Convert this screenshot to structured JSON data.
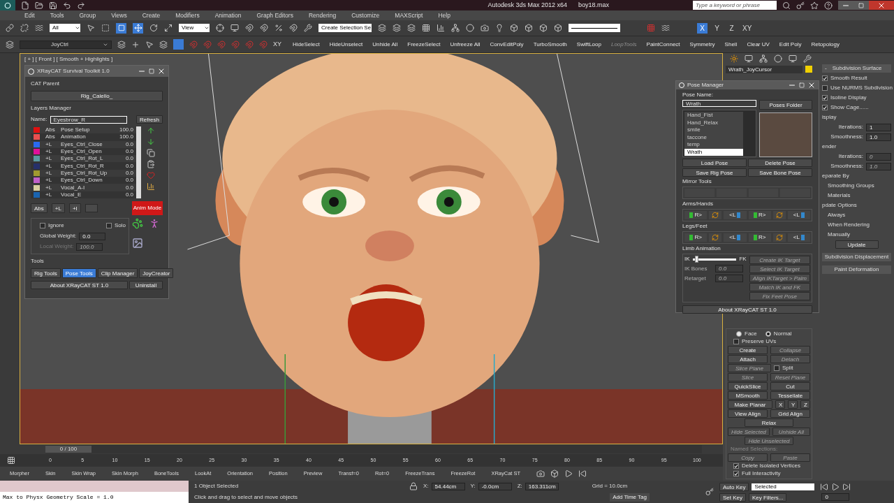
{
  "title_bar": {
    "app_title": "Autodesk 3ds Max  2012 x64",
    "file_name": "boy18.max",
    "search_placeholder": "Type a keyword or phrase"
  },
  "menu": [
    "Edit",
    "Tools",
    "Group",
    "Views",
    "Create",
    "Modifiers",
    "Animation",
    "Graph Editors",
    "Rendering",
    "Customize",
    "MAXScript",
    "Help"
  ],
  "main_toolbar": {
    "selection_filter": "All",
    "reference_coord": "View",
    "named_selection": "Create Selection Se",
    "axes": [
      {
        "label": "X",
        "selected": true
      },
      {
        "label": "Y",
        "selected": false
      },
      {
        "label": "Z",
        "selected": false
      },
      {
        "label": "XY",
        "selected": false
      }
    ]
  },
  "ribbon": {
    "layer": "JoyCtrl",
    "snap_label": "XY",
    "buttons": [
      {
        "label": "HideSelect",
        "disabled": false
      },
      {
        "label": "HideUnselect",
        "disabled": false
      },
      {
        "label": "Unhide All",
        "disabled": false
      },
      {
        "label": "FreezeSelect",
        "disabled": false
      },
      {
        "label": "Unfreeze All",
        "disabled": false
      },
      {
        "label": "ConvEditPoly",
        "disabled": false
      },
      {
        "label": "TurboSmooth",
        "disabled": false
      },
      {
        "label": "SwiftLoop",
        "disabled": false
      },
      {
        "label": "LoopTools",
        "disabled": true
      },
      {
        "label": "PaintConnect",
        "disabled": false
      },
      {
        "label": "Symmetry",
        "disabled": false
      },
      {
        "label": "Shell",
        "disabled": false
      },
      {
        "label": "Clear UV",
        "disabled": false
      },
      {
        "label": "Edit Poly",
        "disabled": false
      },
      {
        "label": "Retopology",
        "disabled": false
      }
    ]
  },
  "viewport": {
    "label": "[ + ] [ Front ] [ Smooth + Highlights ]"
  },
  "xraycat": {
    "title": "XRayCAT Survival Toolkit 1.0",
    "cat_parent_label": "CAT Parent",
    "cat_parent": "Rig_Calello_",
    "layers_label": "Layers Manager",
    "name_label": "Name:",
    "name_value": "Eyesbrow_R",
    "refresh": "Refresh",
    "layers": [
      {
        "color": "#e01010",
        "type": "Abs",
        "name": "Pose Setup",
        "weight": "100.0"
      },
      {
        "color": "#e85050",
        "type": "Abs",
        "name": "Animation",
        "weight": "100.0"
      },
      {
        "color": "#2a6af0",
        "type": "+L",
        "name": "Eyes_Ctrl_Close",
        "weight": "0.0"
      },
      {
        "color": "#e0109a",
        "type": "+L",
        "name": "Eyes_Ctrl_Open",
        "weight": "0.0"
      },
      {
        "color": "#5a9aa0",
        "type": "+L",
        "name": "Eyes_Ctrl_Rot_L",
        "weight": "0.0"
      },
      {
        "color": "#26306a",
        "type": "+L",
        "name": "Eyes_Ctrl_Rot_R",
        "weight": "0.0"
      },
      {
        "color": "#a09a30",
        "type": "+L",
        "name": "Eyes_Ctrl_Rot_Up",
        "weight": "0.0"
      },
      {
        "color": "#c060c8",
        "type": "+L",
        "name": "Eyes_Ctrl_Down",
        "weight": "0.0"
      },
      {
        "color": "#d8d0a0",
        "type": "+L",
        "name": "Vocal_A-I",
        "weight": "0.0"
      },
      {
        "color": "#1a64b0",
        "type": "+L",
        "name": "Vocal_E",
        "weight": "0.0"
      }
    ],
    "add_buttons": [
      "Abs",
      "+L",
      "+I"
    ],
    "anim_mode": "Anim Mode",
    "ignore": {
      "label": "Ignore",
      "checked": false
    },
    "solo": {
      "label": "Solo",
      "checked": false
    },
    "global_weight": {
      "label": "Global Weight:",
      "value": "0.0",
      "disabled": false
    },
    "local_weight": {
      "label": "Local Weight:",
      "value": "100.0",
      "disabled": true
    },
    "tools_label": "Tools",
    "tools": [
      {
        "label": "Rig Tools",
        "selected": false
      },
      {
        "label": "Pose Tools",
        "selected": true
      },
      {
        "label": "Clip Manager",
        "selected": false
      },
      {
        "label": "JoyCreator",
        "selected": false
      }
    ],
    "about": "About XRayCAT ST 1.0",
    "uninstall": "Uninstall"
  },
  "pose_manager": {
    "title": "Pose Manager",
    "pose_name_label": "Pose Name:",
    "pose_name": "Wrath",
    "poses_folder": "Poses Folder",
    "poses": [
      {
        "label": "Hand_Fist",
        "selected": false
      },
      {
        "label": "Hand_Relax",
        "selected": false
      },
      {
        "label": "smile",
        "selected": false
      },
      {
        "label": "taccone",
        "selected": false
      },
      {
        "label": "temp",
        "selected": false
      },
      {
        "label": "Wrath",
        "selected": true
      }
    ],
    "actions": [
      "Load Pose",
      "Delete Pose",
      "Save Rig Pose",
      "Save Bone Pose"
    ],
    "mirror_label": "Mirror Tools",
    "arms_label": "Arms/Hands",
    "legs_label": "Legs/Feet",
    "arms_buttons": [
      {
        "kind": "right",
        "label": "R>"
      },
      {
        "kind": "swap"
      },
      {
        "kind": "left",
        "label": "<L"
      },
      {
        "kind": "right",
        "label": "R>"
      },
      {
        "kind": "swap"
      },
      {
        "kind": "left",
        "label": "<L"
      }
    ],
    "legs_buttons": [
      {
        "kind": "right",
        "label": "R>"
      },
      {
        "kind": "swap"
      },
      {
        "kind": "left",
        "label": "<L"
      },
      {
        "kind": "right",
        "label": "R>"
      },
      {
        "kind": "swap"
      },
      {
        "kind": "left",
        "label": "<L"
      }
    ],
    "limb_label": "Limb Animation",
    "ik": "IK",
    "fk": "FK",
    "blend": {
      "level": 0.05
    },
    "ik_bones": {
      "label": "IK Bones",
      "value": "0.0"
    },
    "retarget": {
      "label": "Retarget",
      "value": "0.0"
    },
    "ik_actions": [
      "Create IK Target",
      "Select IK Target",
      "Align IKTarget > Palm",
      "Match IK and FK",
      "Fix Feet Pose"
    ],
    "about": "About XRayCAT ST 1.0"
  },
  "command_panel": {
    "object_name": "Wrath_JoyCursor",
    "edit_poly": [
      {
        "kind": "radios",
        "items": [
          {
            "label": "Face",
            "selected": false
          },
          {
            "label": "Normal",
            "selected": true
          }
        ]
      },
      {
        "kind": "check",
        "label": "Preserve UVs",
        "checked": false
      },
      {
        "kind": "pair",
        "items": [
          {
            "label": "Create",
            "disabled": false
          },
          {
            "label": "Collapse",
            "disabled": true
          }
        ]
      },
      {
        "kind": "pair",
        "items": [
          {
            "label": "Attach",
            "disabled": false
          },
          {
            "label": "Detach",
            "disabled": true
          }
        ]
      },
      {
        "kind": "split",
        "button": {
          "label": "Slice Plane",
          "disabled": true
        },
        "check": {
          "label": "Split",
          "checked": false
        }
      },
      {
        "kind": "pair",
        "items": [
          {
            "label": "Slice",
            "disabled": true
          },
          {
            "label": "Reset Plane",
            "disabled": true
          }
        ]
      },
      {
        "kind": "pair",
        "items": [
          {
            "label": "QuickSlice",
            "disabled": false
          },
          {
            "label": "Cut",
            "disabled": false
          }
        ]
      },
      {
        "kind": "pair",
        "items": [
          {
            "label": "MSmooth",
            "disabled": false
          },
          {
            "label": "Tessellate",
            "disabled": false
          }
        ]
      },
      {
        "kind": "row",
        "items": [
          {
            "label": "Make Planar",
            "disabled": false
          },
          {
            "label": "X",
            "disabled": false
          },
          {
            "label": "Y",
            "disabled": false
          },
          {
            "label": "Z",
            "disabled": false
          }
        ]
      },
      {
        "kind": "pair",
        "items": [
          {
            "label": "View Align",
            "disabled": false
          },
          {
            "label": "Grid Align",
            "disabled": false
          }
        ]
      },
      {
        "kind": "single",
        "items": [
          {
            "label": "Relax",
            "disabled": false
          }
        ]
      },
      {
        "kind": "pair",
        "items": [
          {
            "label": "Hide Selected",
            "disabled": true
          },
          {
            "label": "Unhide All",
            "disabled": true
          }
        ]
      },
      {
        "kind": "single",
        "items": [
          {
            "label": "Hide Unselected",
            "disabled": true
          }
        ]
      },
      {
        "kind": "label",
        "label": "Named Selections:"
      },
      {
        "kind": "pair",
        "items": [
          {
            "label": "Copy",
            "disabled": true
          },
          {
            "label": "Paste",
            "disabled": true
          }
        ]
      },
      {
        "kind": "check",
        "label": "Delete Isolated Vertices",
        "checked": true
      },
      {
        "kind": "check",
        "label": "Full Interactivity",
        "checked": true
      }
    ],
    "subdivision": {
      "sign": "-",
      "title": "Subdivision Surface",
      "checks": [
        {
          "label": "Smooth Result",
          "checked": true
        },
        {
          "label": "Use NURMS Subdivision",
          "checked": false
        },
        {
          "label": "Isoline Display",
          "checked": true
        },
        {
          "label": "Show Cage......",
          "checked": true
        }
      ],
      "groups": [
        {
          "label": "isplay",
          "fields": [
            {
              "label": "Iterations:",
              "value": "1",
              "disabled": false
            },
            {
              "label": "Smoothness:",
              "value": "1.0",
              "disabled": false
            }
          ]
        },
        {
          "label": "ender",
          "fields": [
            {
              "label": "Iterations:",
              "value": "0",
              "disabled": true
            },
            {
              "label": "Smoothness:",
              "value": "1.0",
              "disabled": true
            }
          ]
        }
      ],
      "separate_label": "eparate By",
      "separate": [
        "Smoothing Groups",
        "Materials"
      ],
      "update_label": "pdate Options",
      "update": [
        "Always",
        "When Rendering",
        "Manually"
      ],
      "update_button": "Update"
    },
    "rollouts": [
      "Subdivision Displacement",
      "Paint Deformation"
    ]
  },
  "timeline": {
    "frame": "0 / 100",
    "level": 0,
    "ticks": [
      "0",
      "5",
      "10",
      "15",
      "20",
      "25",
      "30",
      "35",
      "40",
      "45",
      "50",
      "55",
      "60",
      "65",
      "70",
      "75",
      "80",
      "85",
      "90",
      "95",
      "100"
    ]
  },
  "quick_bar": [
    "Morpher",
    "Skin",
    "Skin Wrap",
    "Skin Morph",
    "BoneTools",
    "LookAt",
    "Orientation",
    "Position",
    "Preview",
    "Transf=0",
    "Rot=0",
    "FreezeTrans",
    "FreezeRot",
    "XRayCat ST"
  ],
  "status_bar": {
    "listener_output": "Max to Physx Geometry Scale = 1.0",
    "selection": "1 Object Selected",
    "prompt": "Click and drag to select and move objects",
    "coords": [
      {
        "label": "X:",
        "value": "54.44cm"
      },
      {
        "label": "Y:",
        "value": "-0.0cm"
      },
      {
        "label": "Z:",
        "value": "163.311cm"
      }
    ],
    "grid": "Grid = 10.0cm",
    "time_tag": "Add Time Tag",
    "auto_key": "Auto Key",
    "key_mode": "Selected",
    "set_key": "Set Key",
    "key_filters": "Key Filters...",
    "frame": "0"
  }
}
